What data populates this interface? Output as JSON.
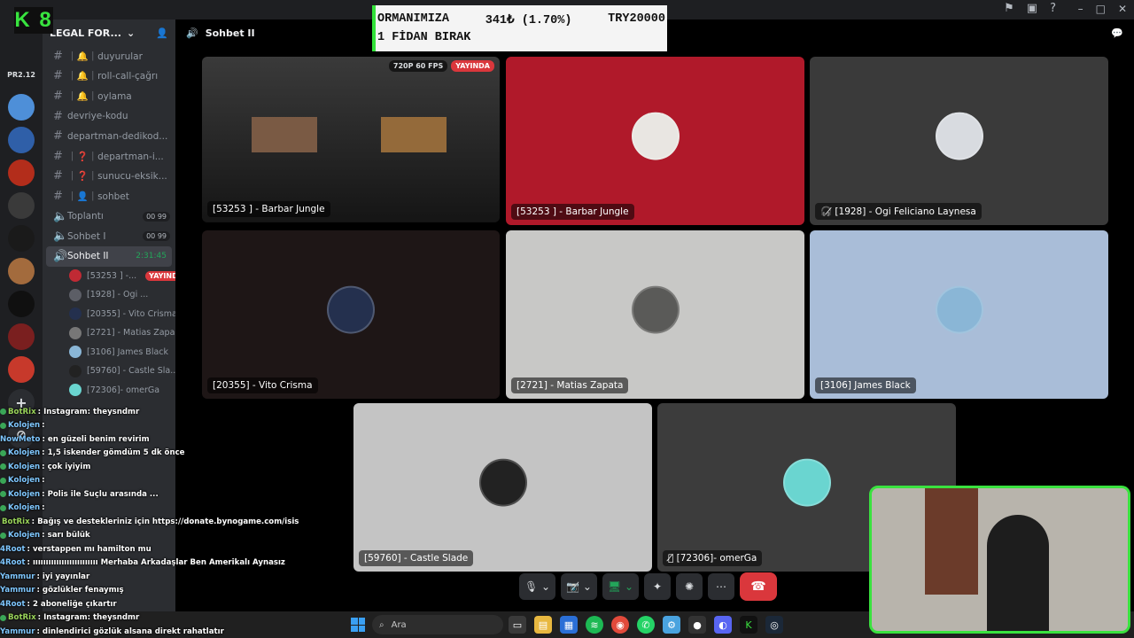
{
  "logo": {
    "text": "K 8"
  },
  "ticker": {
    "line1_left": "ORMANIMIZA",
    "line1_mid": "341₺ (1.70%)",
    "line1_right": "TRY20000",
    "line2": "1 FİDAN BIRAK"
  },
  "server": {
    "name": "LEGAL FOR...",
    "label_pr": "PR2.12"
  },
  "channels": [
    {
      "name": "｜🔔｜duyurular",
      "type": "text"
    },
    {
      "name": "｜🔔｜roll-call-çağrı",
      "type": "text"
    },
    {
      "name": "｜🔔｜oylama",
      "type": "text"
    },
    {
      "name": "devriye-kodu",
      "type": "text"
    },
    {
      "name": "departman-dedikod...",
      "type": "text"
    },
    {
      "name": "｜❓｜departman-i...",
      "type": "text"
    },
    {
      "name": "｜❓｜sunucu-eksik...",
      "type": "text"
    },
    {
      "name": "｜👤｜sohbet",
      "type": "text"
    }
  ],
  "voice_channels": [
    {
      "name": "Toplantı",
      "count_a": "00",
      "count_b": "99"
    },
    {
      "name": "Sohbet I",
      "count_a": "00",
      "count_b": "99"
    }
  ],
  "active_voice": {
    "name": "Sohbet II",
    "timer": "2:31:45"
  },
  "members": [
    {
      "name": "[53253 ] -...",
      "badge": "YAYINDA"
    },
    {
      "name": "[1928] - Ogi ..."
    },
    {
      "name": "[20355] - Vito Crisma"
    },
    {
      "name": "[2721] - Matias Zapa..."
    },
    {
      "name": "[3106] James Black"
    },
    {
      "name": "[59760] - Castle Sla..."
    },
    {
      "name": "[72306]- omerGa"
    }
  ],
  "chat": [
    {
      "user": "BotRix",
      "msg": ": Instagram: theysndmr"
    },
    {
      "user": "Kolojen",
      "msg": ":"
    },
    {
      "user": "NowMeto",
      "msg": ": en güzeli benim revirim"
    },
    {
      "user": "Kolojen",
      "msg": ": 1,5 iskender gömdüm 5 dk önce"
    },
    {
      "user": "Kolojen",
      "msg": ": çok iyiyim"
    },
    {
      "user": "Kolojen",
      "msg": ":"
    },
    {
      "user": "Kolojen",
      "msg": ": Polis ile Suçlu arasında ..."
    },
    {
      "user": "Kolojen",
      "msg": ":"
    },
    {
      "user": "BotRix",
      "msg": ": Bağış ve destekleriniz için https://donate.bynogame.com/isis"
    },
    {
      "user": "Kolojen",
      "msg": ": sarı bülük"
    },
    {
      "user": "4Root",
      "msg": ": verstappen mı hamilton mu"
    },
    {
      "user": "4Root",
      "msg": ": ııııııııııııııııııııııııı Merhaba Arkadaşlar Ben Amerikalı Aynasız"
    },
    {
      "user": "Yammur",
      "msg": ": iyi yayınlar"
    },
    {
      "user": "Yammur",
      "msg": ": gözlükler fenaymış"
    },
    {
      "user": "4Root",
      "msg": ": 2 aboneliğe çıkartır"
    },
    {
      "user": "BotRix",
      "msg": ": Instagram: theysndmr"
    },
    {
      "user": "Yammur",
      "msg": ": dinlendirici gözlük alsana direkt rahatlatır"
    }
  ],
  "call_header": {
    "channel": "Sohbet II"
  },
  "tiles": [
    {
      "name": "[53253 ] - Barbar Jungle",
      "quality": "720P 60 FPS",
      "live": "YAYINDA",
      "bg": "#2a2a2a",
      "kind": "stream"
    },
    {
      "name": "[53253 ] - Barbar Jungle",
      "bg": "#b0192a",
      "avatar": "#e9e6e2"
    },
    {
      "name": "[1928] - Ogi Feliciano Laynesa",
      "bg": "#3a3a3a",
      "avatar": "#d8dbe0"
    },
    {
      "name": "[20355] - Vito Crisma",
      "bg": "#1e1616",
      "avatar": "#24304e"
    },
    {
      "name": "[2721] - Matias Zapata",
      "bg": "#c8c8c6",
      "avatar": "#5a5a58"
    },
    {
      "name": "[3106] James Black",
      "bg": "#a9bdd8",
      "avatar": "#8ab6d6"
    },
    {
      "name": "[59760] - Castle Slade",
      "bg": "#c4c4c4",
      "avatar": "#222222"
    },
    {
      "name": "[72306]- omerGa",
      "bg": "#3c3c3c",
      "avatar": "#6ad5d0"
    }
  ],
  "taskbar": {
    "search_placeholder": "Ara"
  },
  "colors": {
    "accent_green": "#33e23a",
    "live_red": "#da373c",
    "discord_bg": "#2b2d31"
  }
}
